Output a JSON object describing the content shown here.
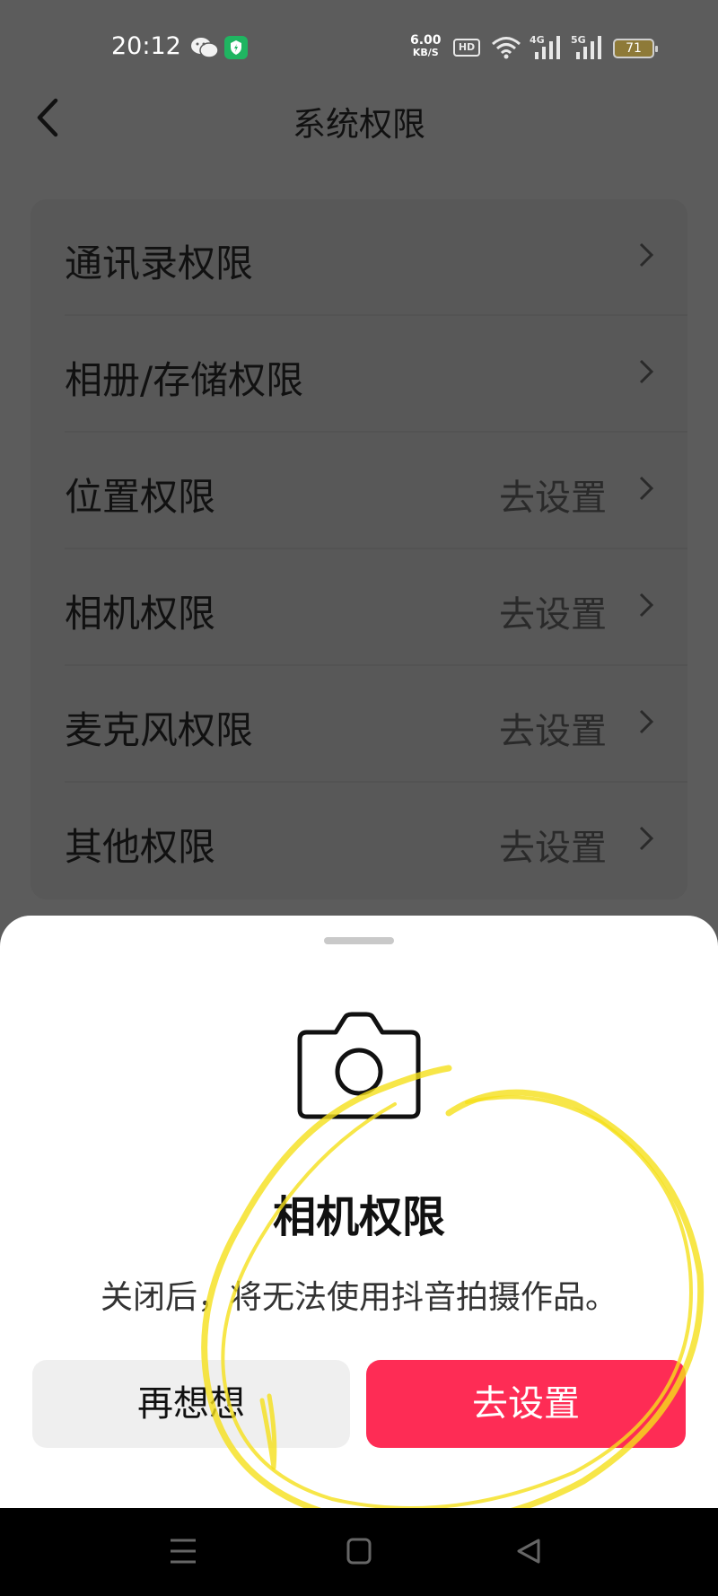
{
  "status_bar": {
    "time": "20:12",
    "net_speed_value": "6.00",
    "net_speed_unit": "KB/S",
    "hd_label": "HD",
    "signal_1_label": "4G",
    "signal_2_label": "5G",
    "battery_level": "71",
    "icons": [
      "wechat-icon",
      "shield-app-icon",
      "wifi-icon",
      "signal-icon",
      "battery-icon"
    ]
  },
  "header": {
    "title": "系统权限",
    "back_icon": "chevron-left-icon"
  },
  "permissions": [
    {
      "label": "通讯录权限",
      "action": ""
    },
    {
      "label": "相册/存储权限",
      "action": ""
    },
    {
      "label": "位置权限",
      "action": "去设置"
    },
    {
      "label": "相机权限",
      "action": "去设置"
    },
    {
      "label": "麦克风权限",
      "action": "去设置"
    },
    {
      "label": "其他权限",
      "action": "去设置"
    }
  ],
  "sheet": {
    "icon": "camera-icon",
    "title": "相机权限",
    "description": "关闭后，将无法使用抖音拍摄作品。",
    "cancel_label": "再想想",
    "confirm_label": "去设置"
  },
  "colors": {
    "primary": "#fe2c55",
    "overlay": "#5c5c5c",
    "highlight_scribble": "#f5e01a"
  },
  "nav_bar": {
    "icons": [
      "menu-icon",
      "home-icon",
      "back-triangle-icon"
    ]
  }
}
